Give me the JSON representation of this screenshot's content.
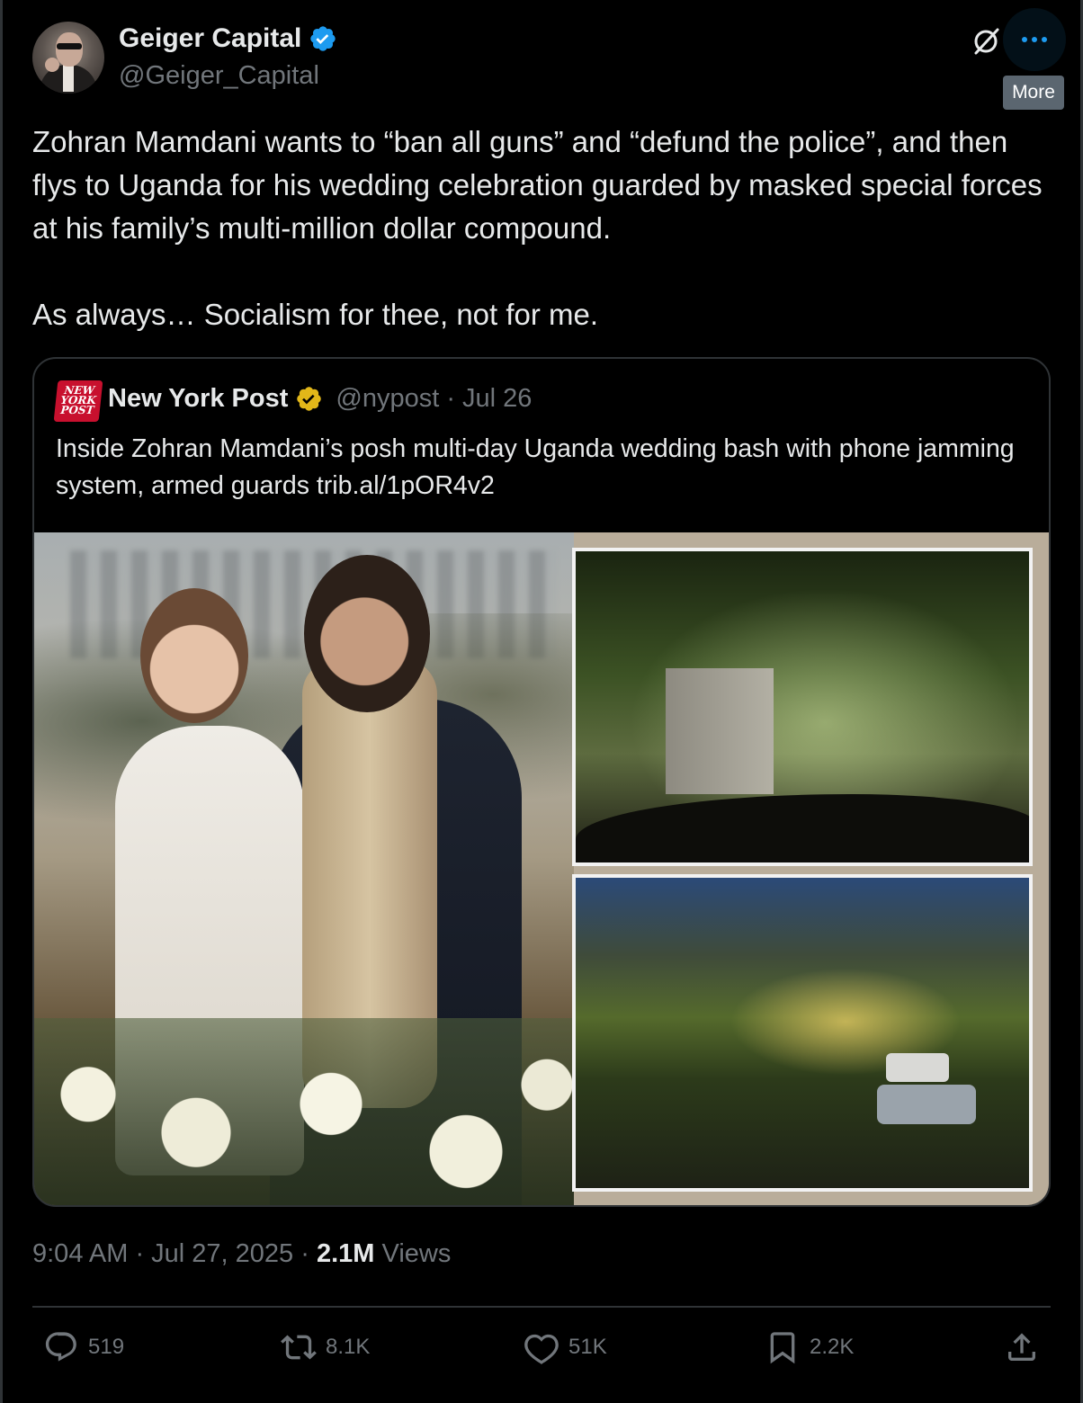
{
  "author": {
    "name": "Geiger Capital",
    "handle": "@Geiger_Capital"
  },
  "header": {
    "more_tooltip": "More"
  },
  "tweet": {
    "text": "Zohran Mamdani wants to “ban all guns” and “defund the police”, and then flys to Uganda for his wedding celebration guarded by masked special forces at his family’s multi-million dollar compound.\n\nAs always… Socialism for thee, not for me."
  },
  "quote": {
    "logo_text": "NEW YORK POST",
    "name": "New York Post",
    "handle_date": "@nypost · Jul 26",
    "text": "Inside Zohran Mamdani’s posh multi-day Uganda wedding bash with phone jamming system, armed guards trib.al/1pOR4v2"
  },
  "meta": {
    "time_date": "9:04 AM · Jul 27, 2025 · ",
    "views_count": "2.1M",
    "views_label": " Views"
  },
  "actions": {
    "replies": "519",
    "reposts": "8.1K",
    "likes": "51K",
    "bookmarks": "2.2K"
  },
  "colors": {
    "background": "#000000",
    "text_primary": "#e7e9ea",
    "text_secondary": "#71767b",
    "accent_blue": "#1d9bf0",
    "verified_gold": "#e2b719",
    "nypost_red": "#c8102e"
  }
}
